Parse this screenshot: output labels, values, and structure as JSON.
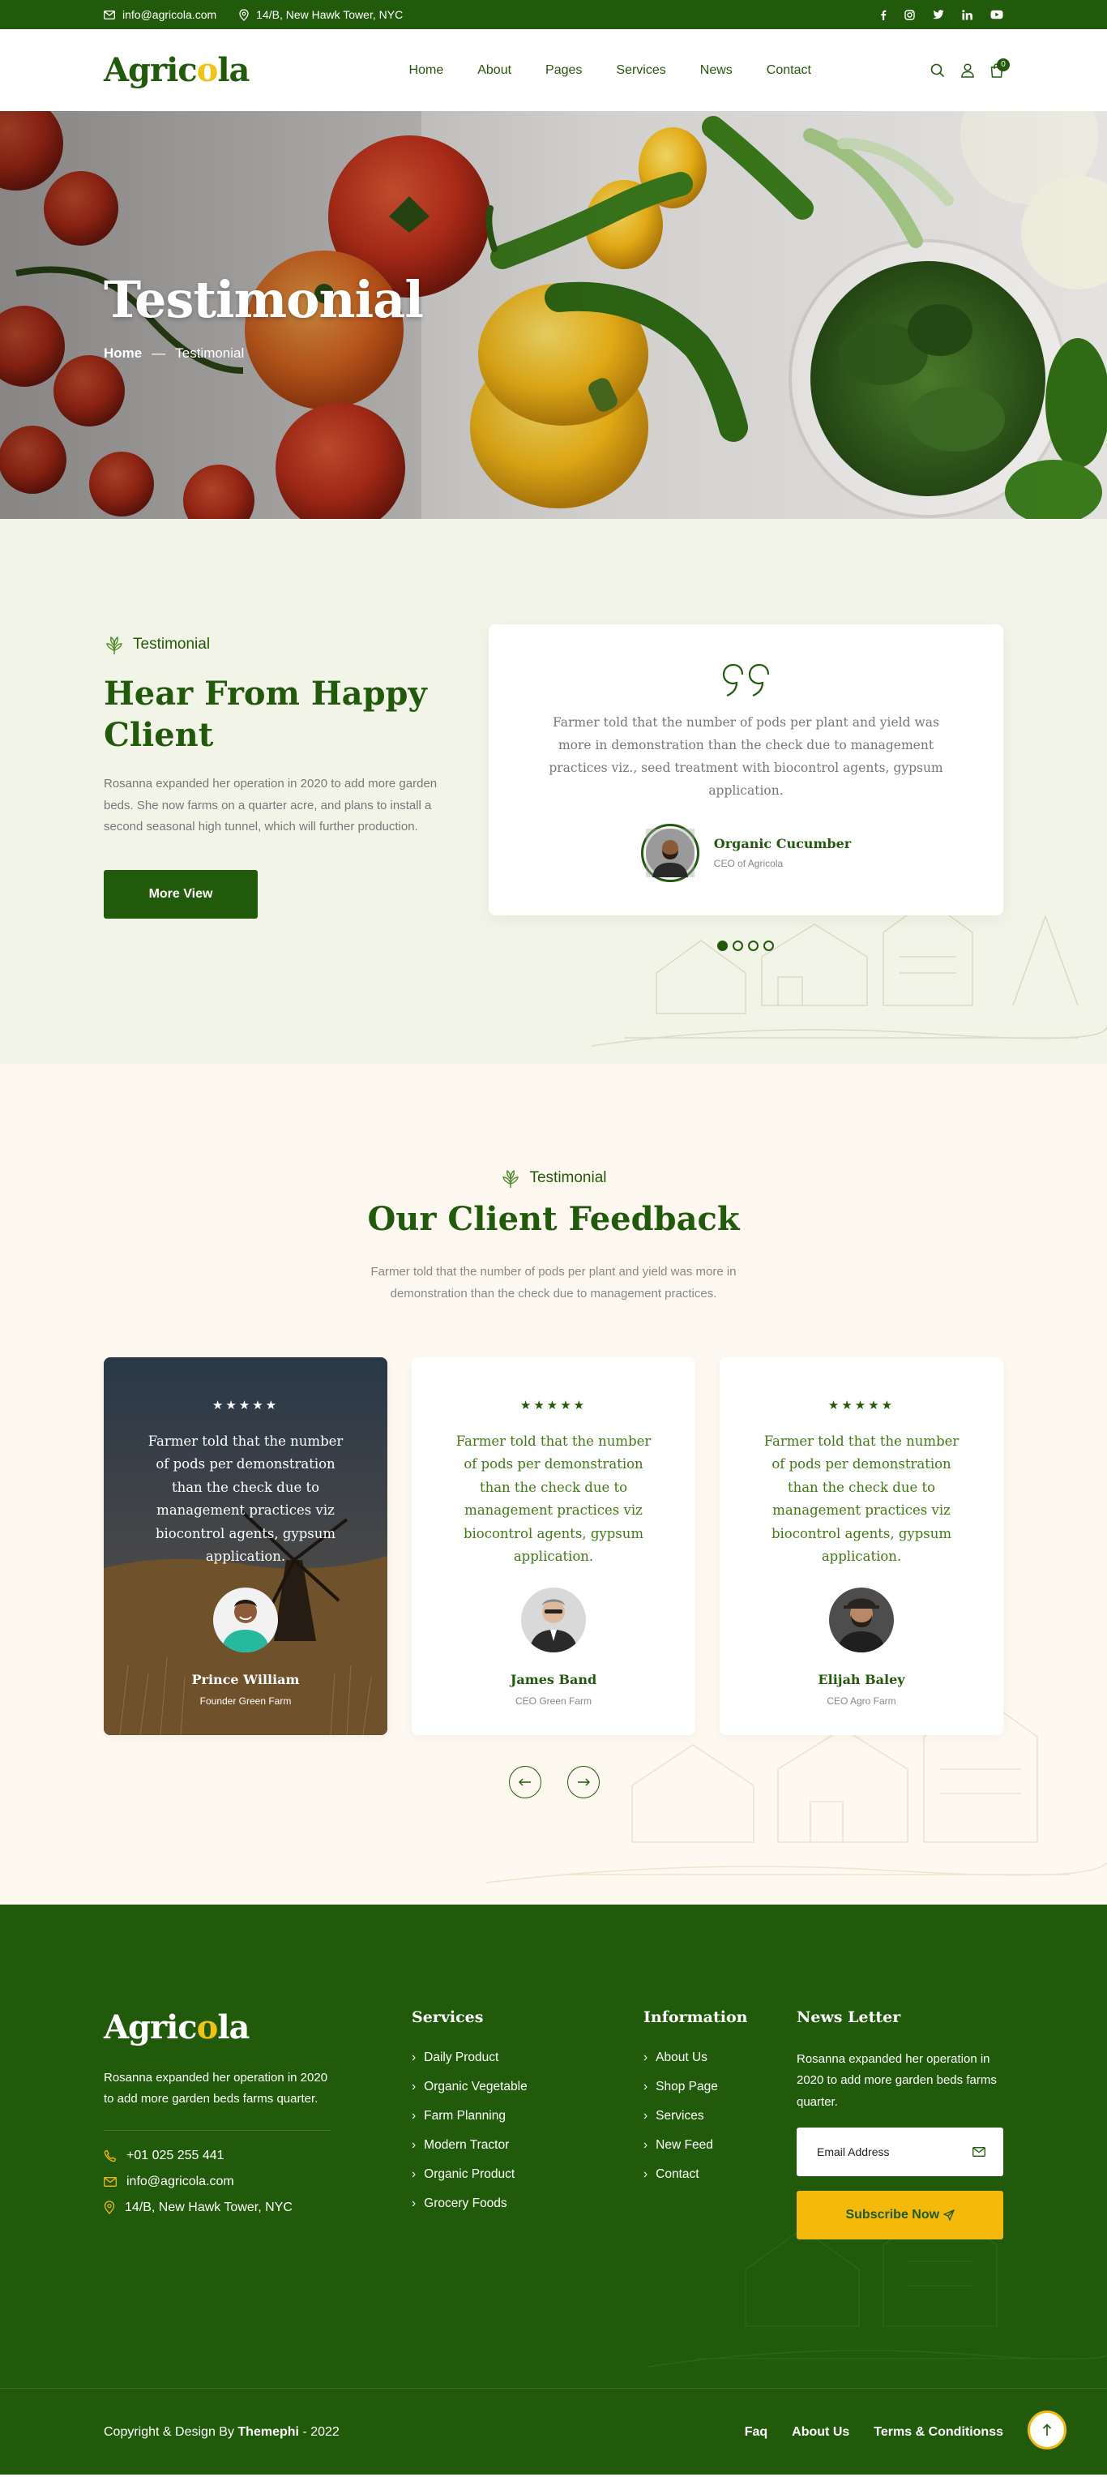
{
  "topbar": {
    "email": "info@agricola.com",
    "address": "14/B, New Hawk Tower, NYC",
    "social": [
      "facebook-icon",
      "instagram-icon",
      "twitter-icon",
      "linkedin-icon",
      "youtube-icon"
    ]
  },
  "header": {
    "logo": {
      "a": "Agric",
      "o": "o",
      "b": "la"
    },
    "nav": [
      "Home",
      "About",
      "Pages",
      "Services",
      "News",
      "Contact"
    ],
    "cart_count": "0"
  },
  "hero": {
    "title": "Testimonial",
    "crumb_home": "Home",
    "crumb_sep": "—",
    "crumb_current": "Testimonial"
  },
  "testimonial": {
    "tag": "Testimonial",
    "title": "Hear From Happy Client",
    "text": "Rosanna expanded her operation in 2020 to add more garden beds. She now farms on a quarter acre, and plans to install a second seasonal high tunnel, which will further production.",
    "button": "More View",
    "quote": "Farmer told that the number of pods per plant and yield was more in demonstration than the check due to management practices viz., seed treatment with biocontrol agents, gypsum application.",
    "name": "Organic Cucumber",
    "role": "CEO of Agricola"
  },
  "feedback": {
    "tag": "Testimonial",
    "title": "Our Client Feedback",
    "text": "Farmer told that the number of pods per plant and yield was more in demonstration than the check due to management practices.",
    "stars": "★★★★★",
    "cards": [
      {
        "text": "Farmer told that the number of pods per demonstration than the check due to management practices viz biocontrol agents, gypsum application.",
        "name": "Prince William",
        "role": "Founder Green Farm"
      },
      {
        "text": "Farmer told that the number of pods per demonstration than the check due to management practices viz biocontrol agents, gypsum application.",
        "name": "James Band",
        "role": "CEO Green Farm"
      },
      {
        "text": "Farmer told that the number of pods per demonstration than the check due to management practices viz biocontrol agents, gypsum application.",
        "name": "Elijah Baley",
        "role": "CEO Agro Farm"
      }
    ]
  },
  "footer": {
    "about": "Rosanna expanded her operation in 2020 to add more garden beds farms quarter.",
    "phone": "+01 025 255 441",
    "email": "info@agricola.com",
    "address": "14/B, New Hawk Tower, NYC",
    "services_title": "Services",
    "services": [
      "Daily Product",
      "Organic Vegetable",
      "Farm Planning",
      "Modern Tractor",
      "Organic Product",
      "Grocery Foods"
    ],
    "info_title": "Information",
    "info": [
      "About Us",
      "Shop Page",
      "Services",
      "New Feed",
      "Contact"
    ],
    "newsletter_title": "News Letter",
    "newsletter_text": "Rosanna expanded her operation in 2020 to add more garden beds farms quarter.",
    "email_placeholder": "Email Address",
    "subscribe": "Subscribe Now",
    "copyright_prefix": "Copyright & Design By ",
    "copyright_brand": "Themephi",
    "copyright_year": " - 2022",
    "bottom_links": [
      "Faq",
      "About Us",
      "Terms & Conditionss"
    ]
  }
}
